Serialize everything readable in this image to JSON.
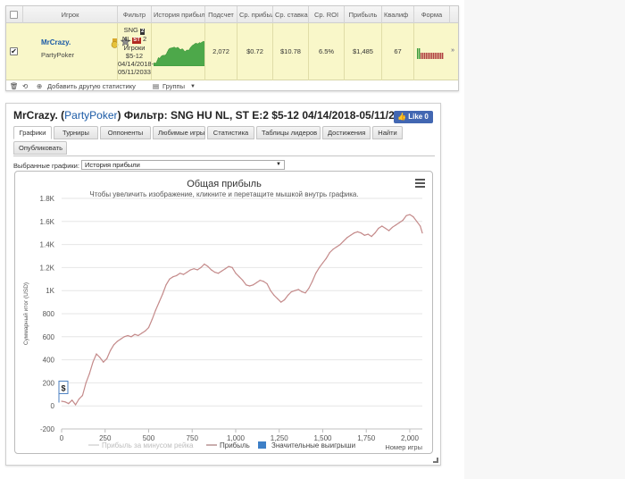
{
  "table": {
    "headers": [
      "Игрок",
      "Фильтр",
      "История прибыли",
      "Подсчет",
      "Ср. прибыль",
      "Ср. ставка",
      "Ср. ROI",
      "Прибыль",
      "Квалиф",
      "Форма"
    ],
    "row": {
      "player": "MrCrazy.",
      "site": "PartyPoker",
      "filter_line1": "SNG",
      "filter_badge1": "2",
      "filter_line2": "NL",
      "filter_badge2": "ST",
      "filter_badge3": "2",
      "filter_line3": "Игроки",
      "filter_line4": "$5-12",
      "filter_line5": "04/14/2018-",
      "filter_line6": "05/11/2033",
      "count": "2,072",
      "avg_profit": "$0.72",
      "avg_stake": "$10.78",
      "avg_roi": "6.5%",
      "profit": "$1,485",
      "qualif": "67",
      "trailing": "»",
      "form_bars": [
        1,
        1,
        0,
        0,
        0,
        0,
        0,
        0,
        0,
        0,
        0,
        0,
        0,
        0,
        0
      ]
    },
    "footer": {
      "add_stats": "Добавить другую статистику",
      "groups": "Группы"
    }
  },
  "profile": {
    "title_player": "MrCrazy.",
    "title_site": "PartyPoker",
    "title_filter": "Фильтр: SNG HU NL, ST E:2 $5-12 04/14/2018-05/11/2033",
    "like": "Like 0",
    "tabs": [
      "Графики",
      "Турниры",
      "Оппоненты",
      "Любимые игры",
      "Статистика",
      "Таблицы лидеров",
      "Достижения",
      "Найти",
      "Опубликовать"
    ],
    "select_label": "Выбранные графики:",
    "select_value": "История прибыли"
  },
  "chart_data": {
    "type": "line",
    "title": "Общая прибыль",
    "subtitle": "Чтобы увеличить изображение, кликните и перетащите мышкой внутрь графика.",
    "xlabel": "Номер игры",
    "ylabel": "Суммарный итог (USD)",
    "xlim": [
      0,
      2072
    ],
    "ylim": [
      -200,
      1800
    ],
    "x_ticks": [
      "0",
      "250",
      "500",
      "750",
      "1,000",
      "1,250",
      "1,500",
      "1,750",
      "2,000"
    ],
    "x_tick_values": [
      0,
      250,
      500,
      750,
      1000,
      1250,
      1500,
      1750,
      2000
    ],
    "y_ticks": [
      "-200",
      "0",
      "200",
      "400",
      "600",
      "800",
      "1K",
      "1.2K",
      "1.4K",
      "1.6K",
      "1.8K"
    ],
    "y_tick_values": [
      -200,
      0,
      200,
      400,
      600,
      800,
      1000,
      1200,
      1400,
      1600,
      1800
    ],
    "series": [
      {
        "name": "Прибыль",
        "color": "#c48a8a",
        "points": [
          [
            0,
            40
          ],
          [
            20,
            35
          ],
          [
            40,
            20
          ],
          [
            60,
            50
          ],
          [
            80,
            10
          ],
          [
            100,
            60
          ],
          [
            120,
            90
          ],
          [
            140,
            200
          ],
          [
            160,
            280
          ],
          [
            180,
            380
          ],
          [
            200,
            450
          ],
          [
            220,
            420
          ],
          [
            240,
            380
          ],
          [
            260,
            410
          ],
          [
            280,
            480
          ],
          [
            300,
            530
          ],
          [
            320,
            560
          ],
          [
            340,
            580
          ],
          [
            360,
            600
          ],
          [
            380,
            610
          ],
          [
            400,
            600
          ],
          [
            420,
            620
          ],
          [
            440,
            610
          ],
          [
            460,
            630
          ],
          [
            480,
            650
          ],
          [
            500,
            680
          ],
          [
            520,
            750
          ],
          [
            540,
            830
          ],
          [
            560,
            900
          ],
          [
            580,
            970
          ],
          [
            600,
            1050
          ],
          [
            620,
            1100
          ],
          [
            640,
            1120
          ],
          [
            660,
            1130
          ],
          [
            680,
            1150
          ],
          [
            700,
            1140
          ],
          [
            720,
            1160
          ],
          [
            740,
            1180
          ],
          [
            760,
            1190
          ],
          [
            780,
            1180
          ],
          [
            800,
            1200
          ],
          [
            820,
            1230
          ],
          [
            840,
            1210
          ],
          [
            860,
            1180
          ],
          [
            880,
            1160
          ],
          [
            900,
            1150
          ],
          [
            920,
            1170
          ],
          [
            940,
            1190
          ],
          [
            960,
            1210
          ],
          [
            980,
            1200
          ],
          [
            1000,
            1150
          ],
          [
            1020,
            1120
          ],
          [
            1040,
            1090
          ],
          [
            1060,
            1050
          ],
          [
            1080,
            1040
          ],
          [
            1100,
            1050
          ],
          [
            1120,
            1070
          ],
          [
            1140,
            1090
          ],
          [
            1160,
            1080
          ],
          [
            1180,
            1060
          ],
          [
            1200,
            1000
          ],
          [
            1220,
            960
          ],
          [
            1240,
            930
          ],
          [
            1260,
            900
          ],
          [
            1280,
            920
          ],
          [
            1300,
            960
          ],
          [
            1320,
            990
          ],
          [
            1340,
            1000
          ],
          [
            1360,
            1010
          ],
          [
            1380,
            990
          ],
          [
            1400,
            980
          ],
          [
            1420,
            1020
          ],
          [
            1440,
            1080
          ],
          [
            1460,
            1150
          ],
          [
            1480,
            1200
          ],
          [
            1500,
            1240
          ],
          [
            1520,
            1280
          ],
          [
            1540,
            1330
          ],
          [
            1560,
            1360
          ],
          [
            1580,
            1380
          ],
          [
            1600,
            1400
          ],
          [
            1620,
            1430
          ],
          [
            1640,
            1460
          ],
          [
            1660,
            1480
          ],
          [
            1680,
            1500
          ],
          [
            1700,
            1510
          ],
          [
            1720,
            1500
          ],
          [
            1740,
            1480
          ],
          [
            1760,
            1490
          ],
          [
            1780,
            1470
          ],
          [
            1800,
            1500
          ],
          [
            1820,
            1540
          ],
          [
            1840,
            1560
          ],
          [
            1860,
            1540
          ],
          [
            1880,
            1520
          ],
          [
            1900,
            1550
          ],
          [
            1920,
            1570
          ],
          [
            1940,
            1590
          ],
          [
            1960,
            1610
          ],
          [
            1980,
            1650
          ],
          [
            2000,
            1660
          ],
          [
            2020,
            1640
          ],
          [
            2040,
            1600
          ],
          [
            2060,
            1560
          ],
          [
            2072,
            1500
          ]
        ]
      }
    ],
    "legend": [
      "Прибыль за минусом рейка",
      "Прибыль",
      "Значительные выигрыши"
    ],
    "legend_colors": [
      "#d6d6d6",
      "#b89393",
      "#3d7fc7"
    ],
    "legend_position": "bottom",
    "flag_label": "$",
    "flag_at": [
      0,
      60
    ]
  }
}
